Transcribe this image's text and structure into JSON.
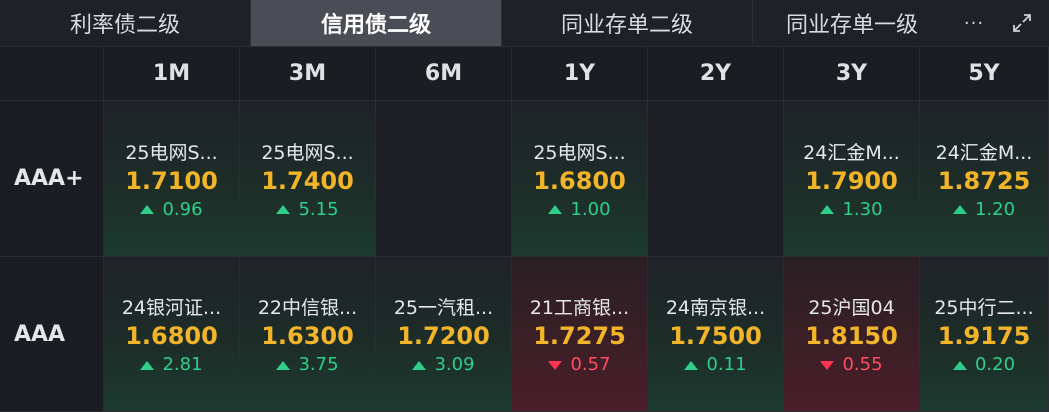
{
  "tabs": [
    {
      "label": "利率债二级"
    },
    {
      "label": "信用债二级"
    },
    {
      "label": "同业存单二级"
    },
    {
      "label": "同业存单一级"
    }
  ],
  "more_label": "···",
  "columns": [
    "1M",
    "3M",
    "6M",
    "1Y",
    "2Y",
    "3Y",
    "5Y"
  ],
  "rows": [
    {
      "label": "AAA+",
      "cells": [
        {
          "bond": "25电网S...",
          "yield": "1.7100",
          "change": "0.96",
          "dir": "up"
        },
        {
          "bond": "25电网S...",
          "yield": "1.7400",
          "change": "5.15",
          "dir": "up"
        },
        null,
        {
          "bond": "25电网S...",
          "yield": "1.6800",
          "change": "1.00",
          "dir": "up"
        },
        null,
        {
          "bond": "24汇金M...",
          "yield": "1.7900",
          "change": "1.30",
          "dir": "up"
        },
        {
          "bond": "24汇金M...",
          "yield": "1.8725",
          "change": "1.20",
          "dir": "up"
        }
      ]
    },
    {
      "label": "AAA",
      "cells": [
        {
          "bond": "24银河证...",
          "yield": "1.6800",
          "change": "2.81",
          "dir": "up"
        },
        {
          "bond": "22中信银...",
          "yield": "1.6300",
          "change": "3.75",
          "dir": "up"
        },
        {
          "bond": "25一汽租...",
          "yield": "1.7200",
          "change": "3.09",
          "dir": "up"
        },
        {
          "bond": "21工商银...",
          "yield": "1.7275",
          "change": "0.57",
          "dir": "down"
        },
        {
          "bond": "24南京银...",
          "yield": "1.7500",
          "change": "0.11",
          "dir": "up"
        },
        {
          "bond": "25沪国04",
          "yield": "1.8150",
          "change": "0.55",
          "dir": "down"
        },
        {
          "bond": "25中行二...",
          "yield": "1.9175",
          "change": "0.20",
          "dir": "up"
        }
      ]
    }
  ],
  "icons": {
    "more": "more-dots-icon",
    "expand": "expand-icon"
  },
  "colors": {
    "yield": "#f2b52a",
    "up": "#2fcf8a",
    "down": "#ff3552",
    "active_tab": "#4a4d55"
  }
}
